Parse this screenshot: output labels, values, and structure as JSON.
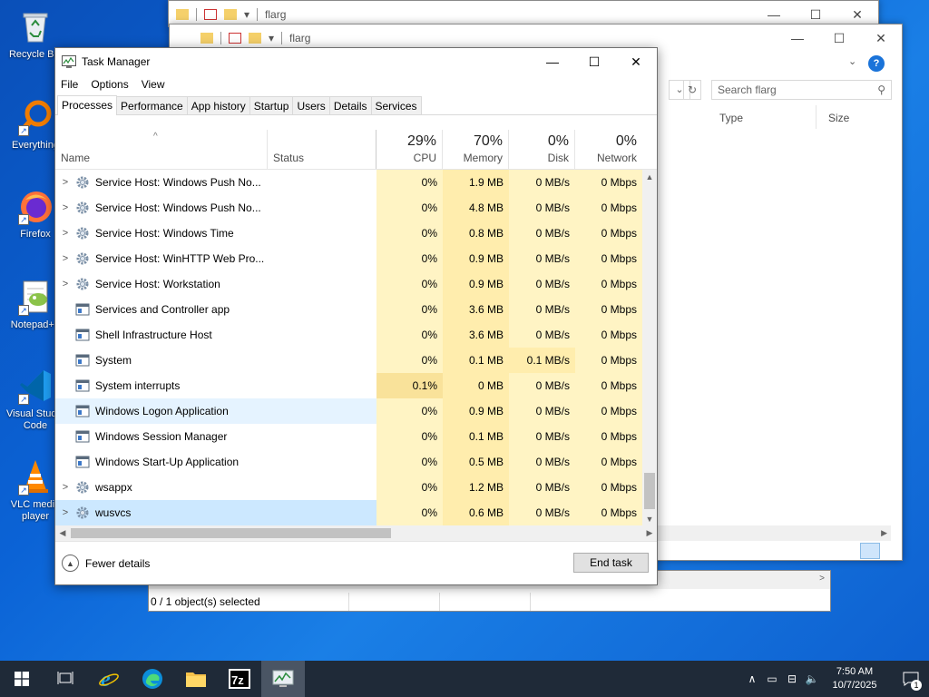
{
  "desktop": {
    "icons": [
      {
        "label": "Recycle Bin",
        "icon": "recycle-bin-icon"
      },
      {
        "label": "Everything",
        "icon": "everything-search-icon"
      },
      {
        "label": "Firefox",
        "icon": "firefox-icon"
      },
      {
        "label": "Notepad++",
        "icon": "notepad-plus-plus-icon"
      },
      {
        "label": "Visual Studio Code",
        "icon": "vscode-icon"
      },
      {
        "label": "VLC media player",
        "icon": "vlc-icon"
      }
    ]
  },
  "explorer_back": {
    "title": "flarg"
  },
  "explorer_front": {
    "title": "flarg",
    "search_placeholder": "Search flarg",
    "columns": [
      "Type",
      "Size"
    ],
    "status": "0 / 1 object(s) selected"
  },
  "task_manager": {
    "title": "Task Manager",
    "menu": [
      "File",
      "Options",
      "View"
    ],
    "tabs": [
      "Processes",
      "Performance",
      "App history",
      "Startup",
      "Users",
      "Details",
      "Services"
    ],
    "columns": {
      "name": "Name",
      "status": "Status",
      "cpu": {
        "pct": "29%",
        "label": "CPU"
      },
      "memory": {
        "pct": "70%",
        "label": "Memory"
      },
      "disk": {
        "pct": "0%",
        "label": "Disk"
      },
      "network": {
        "pct": "0%",
        "label": "Network"
      }
    },
    "rows": [
      {
        "name": "Service Host: Windows Push No...",
        "expandable": true,
        "icon": "gear",
        "cpu": "0%",
        "mem": "1.9 MB",
        "disk": "0 MB/s",
        "net": "0 Mbps"
      },
      {
        "name": "Service Host: Windows Push No...",
        "expandable": true,
        "icon": "gear",
        "cpu": "0%",
        "mem": "4.8 MB",
        "disk": "0 MB/s",
        "net": "0 Mbps"
      },
      {
        "name": "Service Host: Windows Time",
        "expandable": true,
        "icon": "gear",
        "cpu": "0%",
        "mem": "0.8 MB",
        "disk": "0 MB/s",
        "net": "0 Mbps"
      },
      {
        "name": "Service Host: WinHTTP Web Pro...",
        "expandable": true,
        "icon": "gear",
        "cpu": "0%",
        "mem": "0.9 MB",
        "disk": "0 MB/s",
        "net": "0 Mbps"
      },
      {
        "name": "Service Host: Workstation",
        "expandable": true,
        "icon": "gear",
        "cpu": "0%",
        "mem": "0.9 MB",
        "disk": "0 MB/s",
        "net": "0 Mbps"
      },
      {
        "name": "Services and Controller app",
        "expandable": false,
        "icon": "window",
        "cpu": "0%",
        "mem": "3.6 MB",
        "disk": "0 MB/s",
        "net": "0 Mbps"
      },
      {
        "name": "Shell Infrastructure Host",
        "expandable": false,
        "icon": "window",
        "cpu": "0%",
        "mem": "3.6 MB",
        "disk": "0 MB/s",
        "net": "0 Mbps"
      },
      {
        "name": "System",
        "expandable": false,
        "icon": "window",
        "cpu": "0%",
        "mem": "0.1 MB",
        "disk": "0.1 MB/s",
        "net": "0 Mbps"
      },
      {
        "name": "System interrupts",
        "expandable": false,
        "icon": "window",
        "cpu": "0.1%",
        "mem": "0 MB",
        "disk": "0 MB/s",
        "net": "0 Mbps"
      },
      {
        "name": "Windows Logon Application",
        "expandable": false,
        "icon": "window",
        "cpu": "0%",
        "mem": "0.9 MB",
        "disk": "0 MB/s",
        "net": "0 Mbps"
      },
      {
        "name": "Windows Session Manager",
        "expandable": false,
        "icon": "window",
        "cpu": "0%",
        "mem": "0.1 MB",
        "disk": "0 MB/s",
        "net": "0 Mbps"
      },
      {
        "name": "Windows Start-Up Application",
        "expandable": false,
        "icon": "window",
        "cpu": "0%",
        "mem": "0.5 MB",
        "disk": "0 MB/s",
        "net": "0 Mbps"
      },
      {
        "name": "wsappx",
        "expandable": true,
        "icon": "gear",
        "cpu": "0%",
        "mem": "1.2 MB",
        "disk": "0 MB/s",
        "net": "0 Mbps"
      },
      {
        "name": "wusvcs",
        "expandable": true,
        "icon": "gear",
        "cpu": "0%",
        "mem": "0.6 MB",
        "disk": "0 MB/s",
        "net": "0 Mbps"
      }
    ],
    "fewer_details": "Fewer details",
    "end_task": "End task"
  },
  "taskbar": {
    "time": "7:50 AM",
    "date": "10/7/2025",
    "notification_count": "1"
  },
  "colors": {
    "desktop_blue": "#0b63d6",
    "taskbar": "#1f2a38",
    "selected_row": "#cce8ff",
    "heat_light": "#fff4c4"
  }
}
